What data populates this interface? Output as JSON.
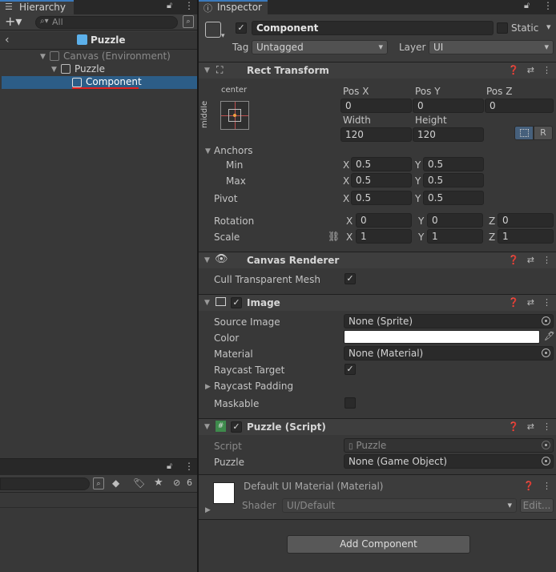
{
  "hierarchy": {
    "tab_label": "Hierarchy",
    "search_placeholder": "All",
    "scene_title": "Puzzle",
    "items": [
      {
        "label": "Canvas (Environment)"
      },
      {
        "label": "Puzzle"
      },
      {
        "label": "Component"
      }
    ]
  },
  "project_panel": {
    "hidden_count": "6"
  },
  "inspector": {
    "tab_label": "Inspector",
    "object_name": "Component",
    "static_label": "Static",
    "tag_label": "Tag",
    "tag_value": "Untagged",
    "layer_label": "Layer",
    "layer_value": "UI",
    "rect_transform": {
      "title": "Rect Transform",
      "anchor_h": "center",
      "anchor_v": "middle",
      "pos_x_label": "Pos X",
      "pos_x": "0",
      "pos_y_label": "Pos Y",
      "pos_y": "0",
      "pos_z_label": "Pos Z",
      "pos_z": "0",
      "width_label": "Width",
      "width": "120",
      "height_label": "Height",
      "height": "120",
      "raw_button": "R",
      "anchors_label": "Anchors",
      "min_label": "Min",
      "min_x": "0.5",
      "min_y": "0.5",
      "max_label": "Max",
      "max_x": "0.5",
      "max_y": "0.5",
      "pivot_label": "Pivot",
      "pivot_x": "0.5",
      "pivot_y": "0.5",
      "rotation_label": "Rotation",
      "rot_x": "0",
      "rot_y": "0",
      "rot_z": "0",
      "scale_label": "Scale",
      "scale_x": "1",
      "scale_y": "1",
      "scale_z": "1",
      "x_axis": "X",
      "y_axis": "Y",
      "z_axis": "Z"
    },
    "canvas_renderer": {
      "title": "Canvas Renderer",
      "cull_label": "Cull Transparent Mesh"
    },
    "image": {
      "title": "Image",
      "source_label": "Source Image",
      "source_value": "None (Sprite)",
      "color_label": "Color",
      "color_value": "#ffffff",
      "material_label": "Material",
      "material_value": "None (Material)",
      "raycast_target_label": "Raycast Target",
      "raycast_padding_label": "Raycast Padding",
      "maskable_label": "Maskable"
    },
    "puzzle_script": {
      "title": "Puzzle (Script)",
      "script_label": "Script",
      "script_value": "Puzzle",
      "puzzle_label": "Puzzle",
      "puzzle_value": "None (Game Object)"
    },
    "material": {
      "title": "Default UI Material (Material)",
      "shader_label": "Shader",
      "shader_value": "UI/Default",
      "edit_label": "Edit..."
    },
    "add_component_label": "Add Component"
  },
  "colors": {
    "selection": "#2c5d87",
    "accent_underline": "#e02020",
    "panel_bg": "#383838",
    "header_bg": "#3e3e3e"
  }
}
